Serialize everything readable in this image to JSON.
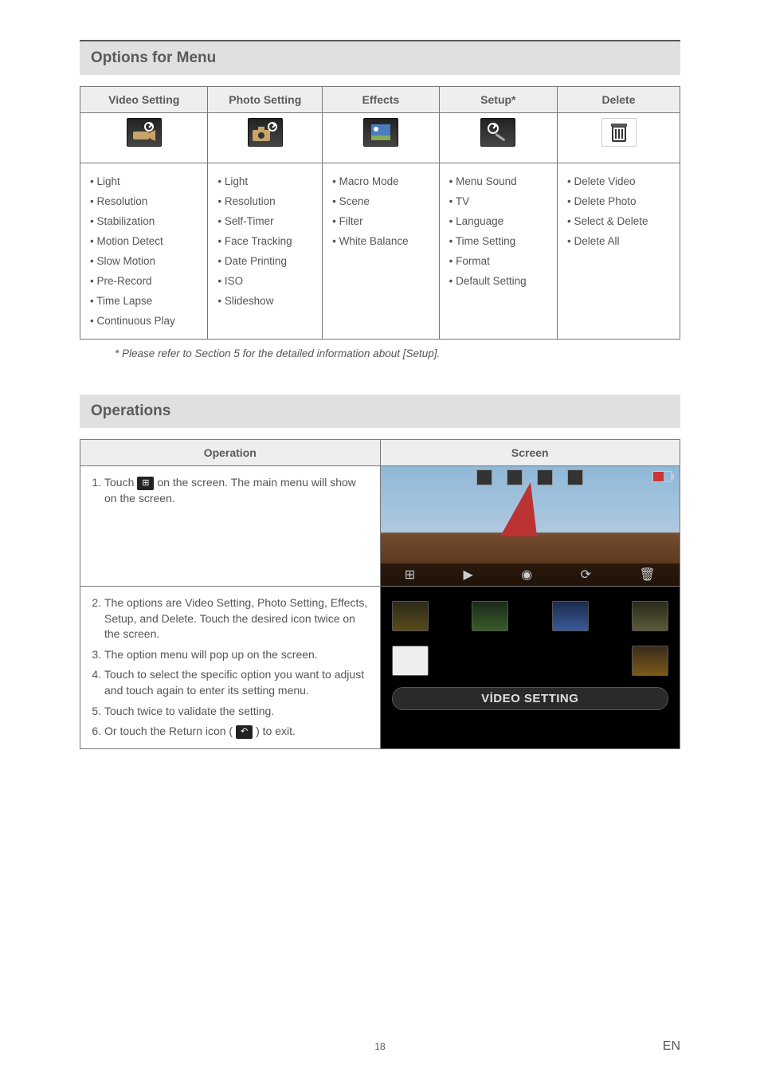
{
  "section1_title": "Options for Menu",
  "menu_headers": [
    "Video Setting",
    "Photo Setting",
    "Effects",
    "Setup*",
    "Delete"
  ],
  "menu_icons": [
    "video-setting-icon",
    "photo-setting-icon",
    "effects-icon",
    "setup-icon",
    "delete-icon"
  ],
  "menu_cols": {
    "video": [
      "Light",
      "Resolution",
      "Stabilization",
      "Motion Detect",
      "Slow Motion",
      "Pre-Record",
      "Time Lapse",
      "Continuous Play"
    ],
    "photo": [
      "Light",
      "Resolution",
      "Self-Timer",
      "Face Tracking",
      "Date Printing",
      "ISO",
      "Slideshow"
    ],
    "effects": [
      "Macro Mode",
      "Scene",
      "Filter",
      "White Balance"
    ],
    "setup": [
      "Menu Sound",
      "TV",
      "Language",
      "Time Setting",
      "Format",
      "Default Setting"
    ],
    "delete": [
      "Delete Video",
      "Delete Photo",
      "Select & Delete",
      "Delete All"
    ]
  },
  "footnote": "* Please refer to Section 5 for the detailed information about [Setup].",
  "section2_title": "Operations",
  "ops_headers": [
    "Operation",
    "Screen"
  ],
  "step1_a": "Touch",
  "step1_b": "on the screen. The main menu will show on the screen.",
  "step2": "The options are Video Setting, Photo Setting, Effects, Setup, and Delete. Touch the desired icon twice on the screen.",
  "step3": "The option menu will pop up on the screen.",
  "step4": "Touch to select the specific option you want to adjust and touch again to enter its setting menu.",
  "step5": "Touch twice to validate the setting.",
  "step6_a": "Or touch the Return icon (",
  "step6_b": ") to exit.",
  "screen2_label": "VİDEO SETTING",
  "grid_glyph": "⊞",
  "bottom_bar_icons": [
    "menu-icon",
    "play-icon",
    "camera-icon",
    "switch-icon",
    "trash-icon"
  ],
  "page_number": "18",
  "lang": "EN",
  "colors": {
    "accent": "#b33",
    "header_bg": "#e0e0e0"
  }
}
